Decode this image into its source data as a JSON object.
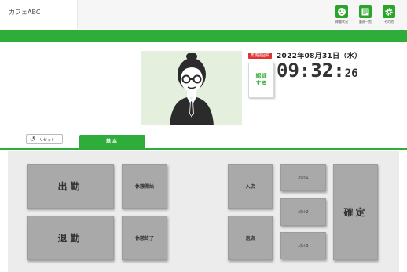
{
  "header": {
    "store_name": "カフェABC",
    "icons": [
      {
        "name": "staff-icon",
        "label": "稼働状況"
      },
      {
        "name": "list-icon",
        "label": "勤務一覧"
      },
      {
        "name": "settings-icon",
        "label": "その他"
      }
    ]
  },
  "auth": {
    "badge": "業務認証中",
    "button_line1": "認証",
    "button_line2": "する"
  },
  "clock": {
    "date": "2022年08月31日（水）",
    "hour_minute": "09:32:",
    "seconds": "26"
  },
  "controls": {
    "reset_label": "リセット",
    "tab_basic": "基本"
  },
  "buttons": {
    "clock_in": "出勤",
    "clock_out": "退勤",
    "break_start": "休憩開始",
    "break_end": "休憩終了",
    "enter": "入店",
    "leave": "退店",
    "count1": "ｶｳﾝﾄ1",
    "count2": "ｶｳﾝﾄ2",
    "count3": "ｶｳﾝﾄ3",
    "confirm": "確定"
  },
  "colors": {
    "accent": "#2fad3b",
    "badge": "#e03434",
    "button": "#a9a9a9"
  }
}
